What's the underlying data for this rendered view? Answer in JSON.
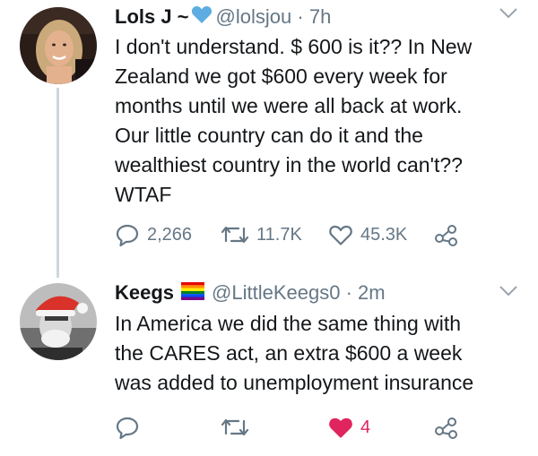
{
  "tweets": [
    {
      "name": "Lols J ~",
      "handle": "@lolsjou",
      "separator": "·",
      "time": "7h",
      "text": "I don't understand. $ 600 is it?? In New\nZealand we got $600 every week for\nmonths until we were all back at work.\nOur little country can do it and the\nwealthiest country in the world can't??\nWTAF",
      "replies": "2,266",
      "retweets": "11.7K",
      "likes": "45.3K",
      "liked": false
    },
    {
      "name": "Keegs",
      "handle": "@LittleKeegs0",
      "separator": "·",
      "time": "2m",
      "text": "In America we did the same thing with\nthe CARES act, an extra $600 a week\nwas added to unemployment insurance",
      "replies": "",
      "retweets": "",
      "likes": "4",
      "liked": true
    }
  ],
  "icons": {
    "verified_heart": "blue-heart-icon",
    "flag": "rainbow-flag-icon",
    "reply": "reply-icon",
    "retweet": "retweet-icon",
    "like": "heart-icon",
    "share": "share-icon",
    "more": "chevron-down-icon"
  },
  "colors": {
    "text": "#14171a",
    "secondary": "#657786",
    "like_active": "#e0245e",
    "heart_emoji": "#5dade2",
    "thread_line": "#cdd6dd"
  }
}
